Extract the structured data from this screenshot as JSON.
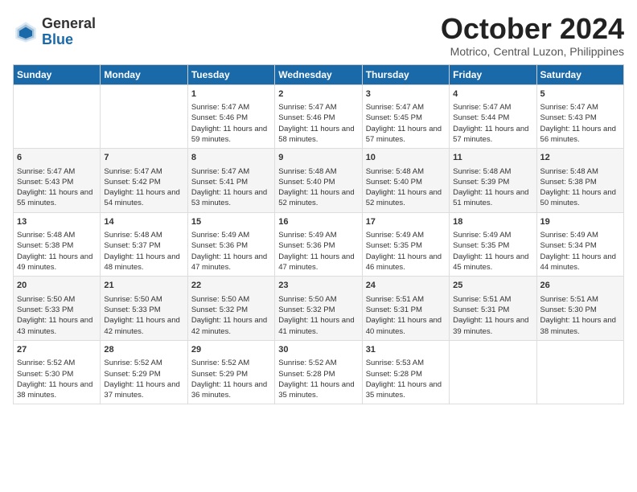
{
  "logo": {
    "general": "General",
    "blue": "Blue"
  },
  "title": "October 2024",
  "location": "Motrico, Central Luzon, Philippines",
  "days_header": [
    "Sunday",
    "Monday",
    "Tuesday",
    "Wednesday",
    "Thursday",
    "Friday",
    "Saturday"
  ],
  "weeks": [
    [
      {
        "day": "",
        "info": ""
      },
      {
        "day": "",
        "info": ""
      },
      {
        "day": "1",
        "info": "Sunrise: 5:47 AM\nSunset: 5:46 PM\nDaylight: 11 hours and 59 minutes."
      },
      {
        "day": "2",
        "info": "Sunrise: 5:47 AM\nSunset: 5:46 PM\nDaylight: 11 hours and 58 minutes."
      },
      {
        "day": "3",
        "info": "Sunrise: 5:47 AM\nSunset: 5:45 PM\nDaylight: 11 hours and 57 minutes."
      },
      {
        "day": "4",
        "info": "Sunrise: 5:47 AM\nSunset: 5:44 PM\nDaylight: 11 hours and 57 minutes."
      },
      {
        "day": "5",
        "info": "Sunrise: 5:47 AM\nSunset: 5:43 PM\nDaylight: 11 hours and 56 minutes."
      }
    ],
    [
      {
        "day": "6",
        "info": "Sunrise: 5:47 AM\nSunset: 5:43 PM\nDaylight: 11 hours and 55 minutes."
      },
      {
        "day": "7",
        "info": "Sunrise: 5:47 AM\nSunset: 5:42 PM\nDaylight: 11 hours and 54 minutes."
      },
      {
        "day": "8",
        "info": "Sunrise: 5:47 AM\nSunset: 5:41 PM\nDaylight: 11 hours and 53 minutes."
      },
      {
        "day": "9",
        "info": "Sunrise: 5:48 AM\nSunset: 5:40 PM\nDaylight: 11 hours and 52 minutes."
      },
      {
        "day": "10",
        "info": "Sunrise: 5:48 AM\nSunset: 5:40 PM\nDaylight: 11 hours and 52 minutes."
      },
      {
        "day": "11",
        "info": "Sunrise: 5:48 AM\nSunset: 5:39 PM\nDaylight: 11 hours and 51 minutes."
      },
      {
        "day": "12",
        "info": "Sunrise: 5:48 AM\nSunset: 5:38 PM\nDaylight: 11 hours and 50 minutes."
      }
    ],
    [
      {
        "day": "13",
        "info": "Sunrise: 5:48 AM\nSunset: 5:38 PM\nDaylight: 11 hours and 49 minutes."
      },
      {
        "day": "14",
        "info": "Sunrise: 5:48 AM\nSunset: 5:37 PM\nDaylight: 11 hours and 48 minutes."
      },
      {
        "day": "15",
        "info": "Sunrise: 5:49 AM\nSunset: 5:36 PM\nDaylight: 11 hours and 47 minutes."
      },
      {
        "day": "16",
        "info": "Sunrise: 5:49 AM\nSunset: 5:36 PM\nDaylight: 11 hours and 47 minutes."
      },
      {
        "day": "17",
        "info": "Sunrise: 5:49 AM\nSunset: 5:35 PM\nDaylight: 11 hours and 46 minutes."
      },
      {
        "day": "18",
        "info": "Sunrise: 5:49 AM\nSunset: 5:35 PM\nDaylight: 11 hours and 45 minutes."
      },
      {
        "day": "19",
        "info": "Sunrise: 5:49 AM\nSunset: 5:34 PM\nDaylight: 11 hours and 44 minutes."
      }
    ],
    [
      {
        "day": "20",
        "info": "Sunrise: 5:50 AM\nSunset: 5:33 PM\nDaylight: 11 hours and 43 minutes."
      },
      {
        "day": "21",
        "info": "Sunrise: 5:50 AM\nSunset: 5:33 PM\nDaylight: 11 hours and 42 minutes."
      },
      {
        "day": "22",
        "info": "Sunrise: 5:50 AM\nSunset: 5:32 PM\nDaylight: 11 hours and 42 minutes."
      },
      {
        "day": "23",
        "info": "Sunrise: 5:50 AM\nSunset: 5:32 PM\nDaylight: 11 hours and 41 minutes."
      },
      {
        "day": "24",
        "info": "Sunrise: 5:51 AM\nSunset: 5:31 PM\nDaylight: 11 hours and 40 minutes."
      },
      {
        "day": "25",
        "info": "Sunrise: 5:51 AM\nSunset: 5:31 PM\nDaylight: 11 hours and 39 minutes."
      },
      {
        "day": "26",
        "info": "Sunrise: 5:51 AM\nSunset: 5:30 PM\nDaylight: 11 hours and 38 minutes."
      }
    ],
    [
      {
        "day": "27",
        "info": "Sunrise: 5:52 AM\nSunset: 5:30 PM\nDaylight: 11 hours and 38 minutes."
      },
      {
        "day": "28",
        "info": "Sunrise: 5:52 AM\nSunset: 5:29 PM\nDaylight: 11 hours and 37 minutes."
      },
      {
        "day": "29",
        "info": "Sunrise: 5:52 AM\nSunset: 5:29 PM\nDaylight: 11 hours and 36 minutes."
      },
      {
        "day": "30",
        "info": "Sunrise: 5:52 AM\nSunset: 5:28 PM\nDaylight: 11 hours and 35 minutes."
      },
      {
        "day": "31",
        "info": "Sunrise: 5:53 AM\nSunset: 5:28 PM\nDaylight: 11 hours and 35 minutes."
      },
      {
        "day": "",
        "info": ""
      },
      {
        "day": "",
        "info": ""
      }
    ]
  ]
}
